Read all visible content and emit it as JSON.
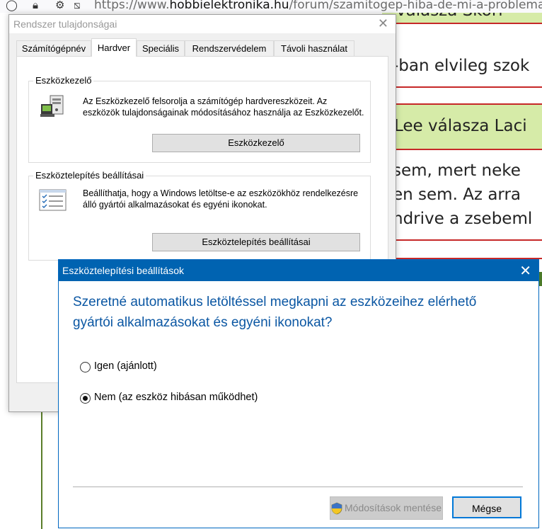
{
  "browser": {
    "url_prefix": "https://www.",
    "url_domain": "hobbielektronika.hu",
    "url_path": "/forum/szamitogep-hiba-de-mi-a-problema"
  },
  "webpage": {
    "header1": "válasza Skori",
    "line1": "-ban elvileg szok",
    "header2": "Lee válasza Laci",
    "line2": " sem, mert neke",
    "line3": "en sem. Az arra",
    "line4": "ndrive a zsebeml"
  },
  "sysprops": {
    "title": "Rendszer tulajdonságai",
    "tabs": [
      "Számítógépnév",
      "Hardver",
      "Speciális",
      "Rendszervédelem",
      "Távoli használat"
    ],
    "device_manager": {
      "title": "Eszközkezelő",
      "description": "Az Eszközkezelő felsorolja a számítógép hardvereszközeit. Az eszközök tulajdonságainak módosításához használja az Eszközkezelőt.",
      "button": "Eszközkezelő"
    },
    "install_settings": {
      "title": "Eszköztelepítés beállításai",
      "description": "Beállíthatja, hogy a Windows letöltse-e az eszközökhöz rendelkezésre álló gyártói alkalmazásokat és egyéni ikonokat.",
      "button": "Eszköztelepítés beállításai"
    }
  },
  "dialog": {
    "title": "Eszköztelepítési beállítások",
    "question": "Szeretné automatikus letöltéssel megkapni az eszközeihez elérhető gyártói alkalmazásokat és egyéni ikonokat?",
    "options": [
      "Igen (ajánlott)",
      "Nem (az eszköz hibásan működhet)"
    ],
    "selected_index": 1,
    "save_button": "Módosítások mentése",
    "cancel_button": "Mégse"
  },
  "colors": {
    "dialog_titlebar": "#0063b1",
    "question_text": "#0b57a3",
    "post_header_bg": "#d6eba8",
    "post_border": "#c62828"
  }
}
